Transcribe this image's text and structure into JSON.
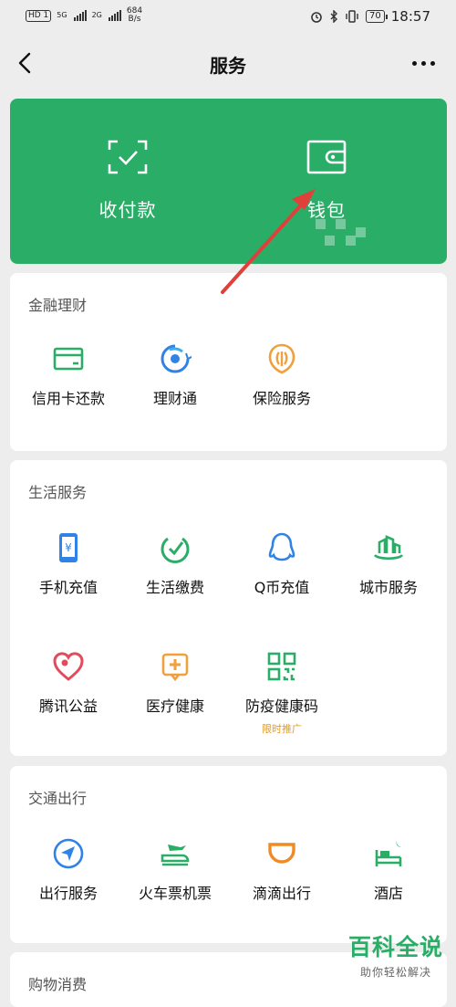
{
  "status_bar": {
    "hd_badge": "HD 1",
    "sim1_type": "5G",
    "sim2_type": "2G",
    "net_speed_value": "684",
    "net_speed_unit": "B/s",
    "battery": "70",
    "time": "18:57"
  },
  "navbar": {
    "title": "服务",
    "back_icon": "chevron-left-icon",
    "more_icon": "more-dots-icon"
  },
  "wallet_card": {
    "color": "#2aae67",
    "items": [
      {
        "label": "收付款",
        "icon": "scan-check-icon"
      },
      {
        "label": "钱包",
        "icon": "wallet-icon"
      }
    ]
  },
  "sections": [
    {
      "title": "金融理财",
      "items": [
        {
          "label": "信用卡还款",
          "icon": "credit-card-icon"
        },
        {
          "label": "理财通",
          "icon": "wealth-icon"
        },
        {
          "label": "保险服务",
          "icon": "insurance-icon"
        }
      ]
    },
    {
      "title": "生活服务",
      "items": [
        {
          "label": "手机充值",
          "icon": "mobile-topup-icon"
        },
        {
          "label": "生活缴费",
          "icon": "utility-bill-icon"
        },
        {
          "label": "Q币充值",
          "icon": "qq-penguin-icon"
        },
        {
          "label": "城市服务",
          "icon": "city-service-icon"
        },
        {
          "label": "腾讯公益",
          "icon": "charity-heart-icon"
        },
        {
          "label": "医疗健康",
          "icon": "medical-icon"
        },
        {
          "label": "防疫健康码",
          "icon": "qr-code-icon",
          "sub": "限时推广"
        }
      ]
    },
    {
      "title": "交通出行",
      "items": [
        {
          "label": "出行服务",
          "icon": "navigation-icon"
        },
        {
          "label": "火车票机票",
          "icon": "train-plane-icon"
        },
        {
          "label": "滴滴出行",
          "icon": "didi-icon"
        },
        {
          "label": "酒店",
          "icon": "hotel-bed-icon"
        }
      ]
    },
    {
      "title": "购物消费",
      "items": []
    }
  ],
  "watermark": {
    "main": "百科全说",
    "sub": "助你轻松解决"
  }
}
